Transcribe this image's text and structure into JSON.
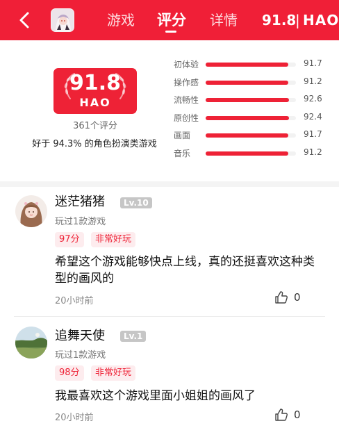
{
  "header": {
    "tabs": [
      "游戏",
      "评分",
      "详情"
    ],
    "active_tab": "评分",
    "score": "91.8",
    "separator": "|",
    "brand": "HAO"
  },
  "summary": {
    "score": "91.8",
    "brand": "HAO",
    "count_text": "361个评分",
    "compare_text": "好于 94.3% 的角色扮演类游戏"
  },
  "dimensions": [
    {
      "label": "初体验",
      "value": "91.7",
      "fraction": 0.917
    },
    {
      "label": "操作感",
      "value": "91.2",
      "fraction": 0.912
    },
    {
      "label": "流畅性",
      "value": "92.6",
      "fraction": 0.926
    },
    {
      "label": "原创性",
      "value": "92.4",
      "fraction": 0.924
    },
    {
      "label": "画面",
      "value": "91.7",
      "fraction": 0.917
    },
    {
      "label": "音乐",
      "value": "91.2",
      "fraction": 0.912
    }
  ],
  "reviews": [
    {
      "username": "迷茫猪猪",
      "level": "Lv.10",
      "played": "玩过1款游戏",
      "score_tag": "97分",
      "verdict_tag": "非常好玩",
      "content": "希望这个游戏能够快点上线，真的还挺喜欢这种类型的画风的",
      "time": "20小时前",
      "likes": "0"
    },
    {
      "username": "追舞天使",
      "level": "Lv.1",
      "played": "玩过1款游戏",
      "score_tag": "98分",
      "verdict_tag": "非常好玩",
      "content": "我最喜欢这个游戏里面小姐姐的画风了",
      "time": "20小时前",
      "likes": "0"
    }
  ],
  "colors": {
    "brand_red": "#f01f37",
    "tag_bg": "#fdecee",
    "level_bg": "#c6c6c6"
  },
  "icons": {
    "back": "chevron-left-icon",
    "like": "thumbs-up-icon",
    "laurel": "laurel-wreath-icon"
  }
}
